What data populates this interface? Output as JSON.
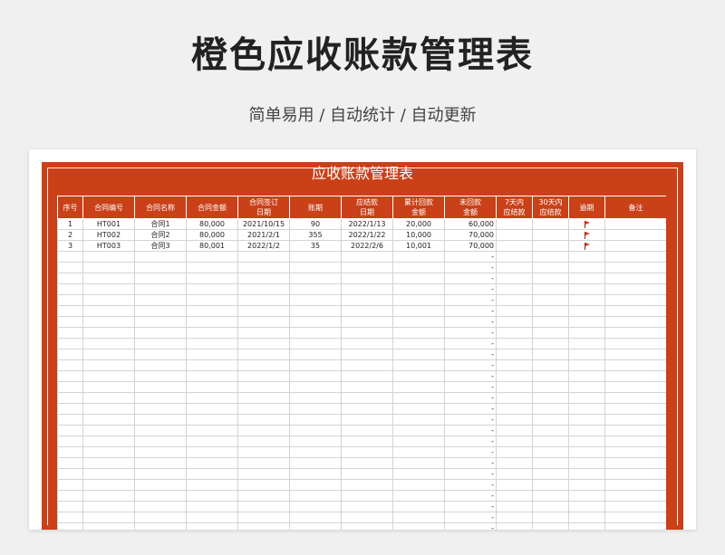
{
  "page": {
    "title": "橙色应收账款管理表",
    "subtitle": "简单易用 / 自动统计 / 自动更新"
  },
  "sheet": {
    "title": "应收账款管理表",
    "accent_color": "#c94019",
    "columns": [
      {
        "key": "seq",
        "label": "序号"
      },
      {
        "key": "contract_no",
        "label": "合同编号"
      },
      {
        "key": "contract_name",
        "label": "合同名称"
      },
      {
        "key": "amount",
        "label": "合同金额"
      },
      {
        "key": "sign_date",
        "label": "合同签订\n日期"
      },
      {
        "key": "term",
        "label": "账期"
      },
      {
        "key": "due_date",
        "label": "应结款\n日期"
      },
      {
        "key": "collected",
        "label": "累计回款\n金额"
      },
      {
        "key": "outstanding",
        "label": "未回款\n金额"
      },
      {
        "key": "due7",
        "label": "7天内\n应结款"
      },
      {
        "key": "due30",
        "label": "30天内\n应结款"
      },
      {
        "key": "overdue",
        "label": "逾期"
      },
      {
        "key": "remark",
        "label": "备注"
      }
    ],
    "rows": [
      {
        "seq": "1",
        "contract_no": "HT001",
        "contract_name": "合同1",
        "amount": "80,000",
        "sign_date": "2021/10/15",
        "term": "90",
        "due_date": "2022/1/13",
        "collected": "20,000",
        "outstanding": "60,000",
        "due7": "",
        "due30": "",
        "overdue": "flag-icon",
        "remark": ""
      },
      {
        "seq": "2",
        "contract_no": "HT002",
        "contract_name": "合同2",
        "amount": "80,000",
        "sign_date": "2021/2/1",
        "term": "355",
        "due_date": "2022/1/22",
        "collected": "10,000",
        "outstanding": "70,000",
        "due7": "",
        "due30": "",
        "overdue": "flag-icon",
        "remark": ""
      },
      {
        "seq": "3",
        "contract_no": "HT003",
        "contract_name": "合同3",
        "amount": "80,001",
        "sign_date": "2022/1/2",
        "term": "35",
        "due_date": "2022/2/6",
        "collected": "10,001",
        "outstanding": "70,000",
        "due7": "",
        "due30": "",
        "overdue": "flag-icon",
        "remark": ""
      }
    ],
    "empty_outstanding_value": "-",
    "empty_row_count": 27
  }
}
